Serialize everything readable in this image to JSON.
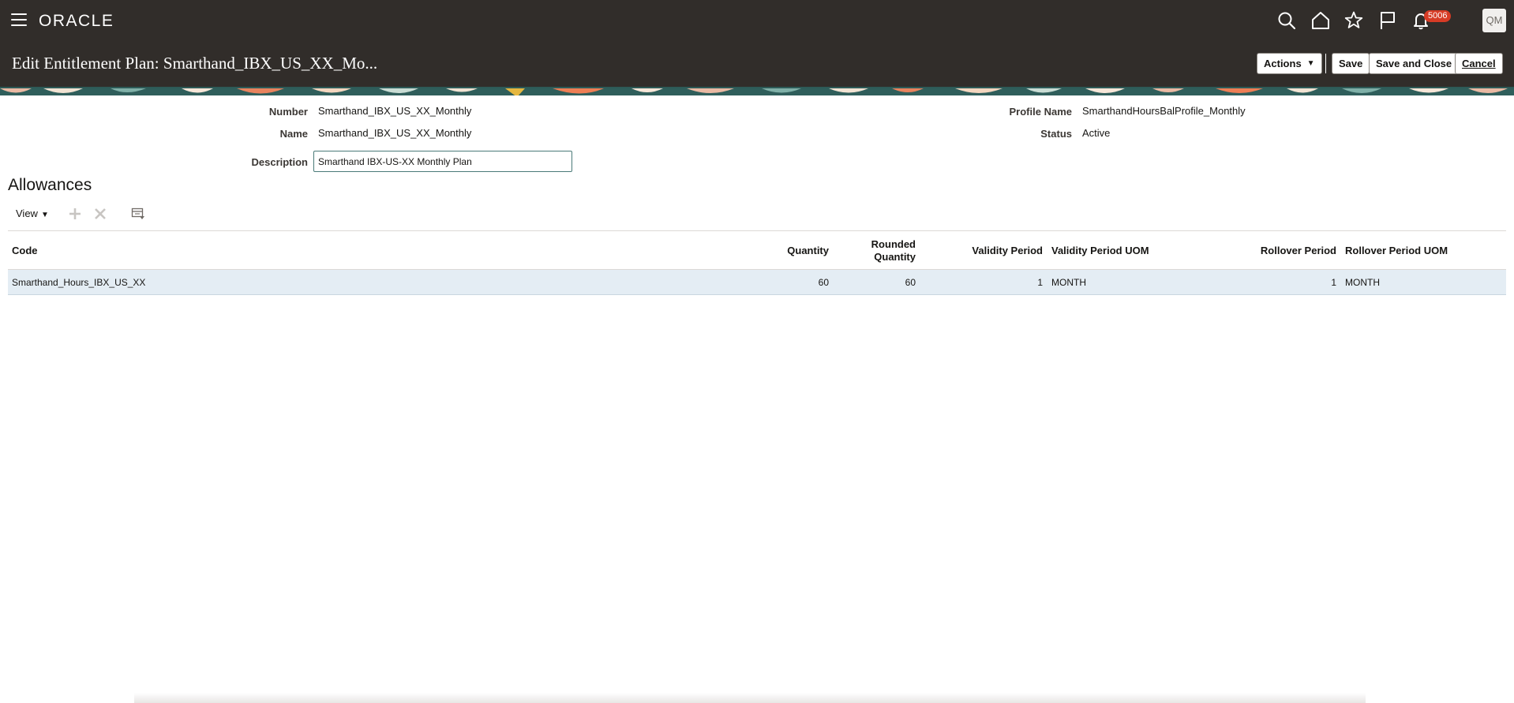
{
  "header": {
    "logo_text": "ORACLE",
    "notification_count": "5006",
    "user_initials": "QM",
    "icons": [
      "menu-icon",
      "search-icon",
      "home-icon",
      "favorites-star-icon",
      "flag-icon",
      "bell-icon"
    ]
  },
  "title_bar": {
    "title": "Edit Entitlement Plan: Smarthand_IBX_US_XX_Mo...",
    "actions_label": "Actions",
    "save_label": "Save",
    "save_close_label": "Save and Close",
    "cancel_label": "Cancel"
  },
  "form": {
    "number_label": "Number",
    "number_value": "Smarthand_IBX_US_XX_Monthly",
    "name_label": "Name",
    "name_value": "Smarthand_IBX_US_XX_Monthly",
    "description_label": "Description",
    "description_value": "Smarthand IBX-US-XX Monthly Plan",
    "profile_name_label": "Profile Name",
    "profile_name_value": "SmarthandHoursBalProfile_Monthly",
    "status_label": "Status",
    "status_value": "Active"
  },
  "allowances": {
    "title": "Allowances",
    "view_label": "View",
    "columns": {
      "code": "Code",
      "quantity": "Quantity",
      "rounded_quantity_line1": "Rounded",
      "rounded_quantity_line2": "Quantity",
      "validity_period": "Validity Period",
      "validity_period_uom": "Validity Period UOM",
      "rollover_period": "Rollover Period",
      "rollover_period_uom": "Rollover Period UOM"
    },
    "rows": [
      {
        "code": "Smarthand_Hours_IBX_US_XX",
        "quantity": "60",
        "rounded_quantity": "60",
        "validity_period": "1",
        "validity_period_uom": "MONTH",
        "rollover_period": "1",
        "rollover_period_uom": "MONTH"
      }
    ]
  },
  "colors": {
    "header_bg": "#312d2a",
    "selected_row_bg": "#e4edf4",
    "badge_red": "#d63b25"
  }
}
